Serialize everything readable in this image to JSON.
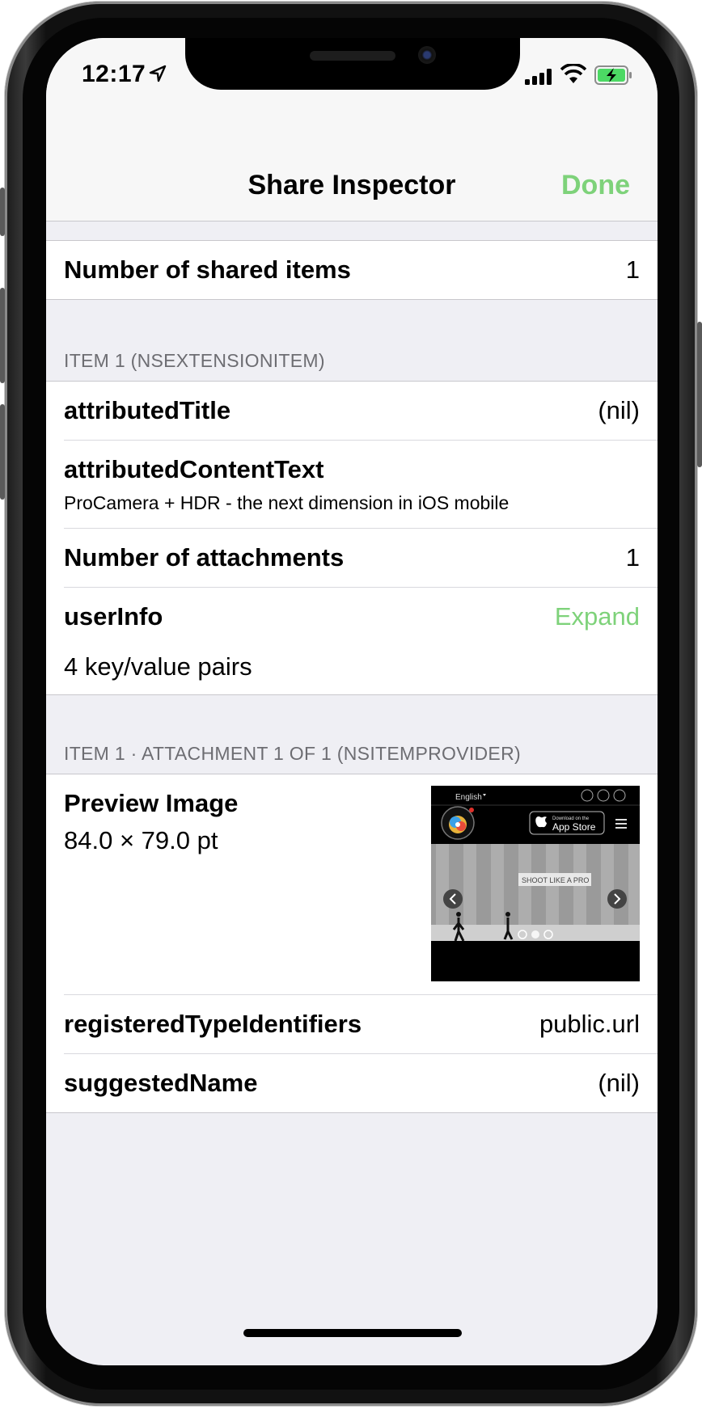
{
  "status_bar": {
    "time": "12:17"
  },
  "nav": {
    "title": "Share Inspector",
    "done_label": "Done"
  },
  "summary": {
    "label": "Number of shared items",
    "value": "1"
  },
  "item_section": {
    "header": "ITEM 1 (NSEXTENSIONITEM)",
    "attributed_title": {
      "label": "attributedTitle",
      "value": "(nil)"
    },
    "attributed_content": {
      "label": "attributedContentText",
      "value": "ProCamera + HDR - the next dimension in iOS mobile"
    },
    "attachments": {
      "label": "Number of attachments",
      "value": "1"
    },
    "user_info": {
      "label": "userInfo",
      "action": "Expand",
      "detail": "4 key/value pairs"
    }
  },
  "attachment_section": {
    "header": "ITEM 1 · ATTACHMENT 1 OF 1 (NSITEMPROVIDER)",
    "preview": {
      "label": "Preview Image",
      "size": "84.0 × 79.0 pt",
      "thumb_language": "English",
      "thumb_store_small": "Download on the",
      "thumb_store_big": "App Store",
      "thumb_caption": "SHOOT LIKE A PRO"
    },
    "registered_types": {
      "label": "registeredTypeIdentifiers",
      "value": "public.url"
    },
    "suggested_name": {
      "label": "suggestedName",
      "value": "(nil)"
    }
  },
  "colors": {
    "accent": "#7ed27a",
    "background": "#efeff4"
  },
  "icons": [
    "location-arrow-icon",
    "cellular-signal-icon",
    "wifi-icon",
    "battery-charging-icon"
  ]
}
